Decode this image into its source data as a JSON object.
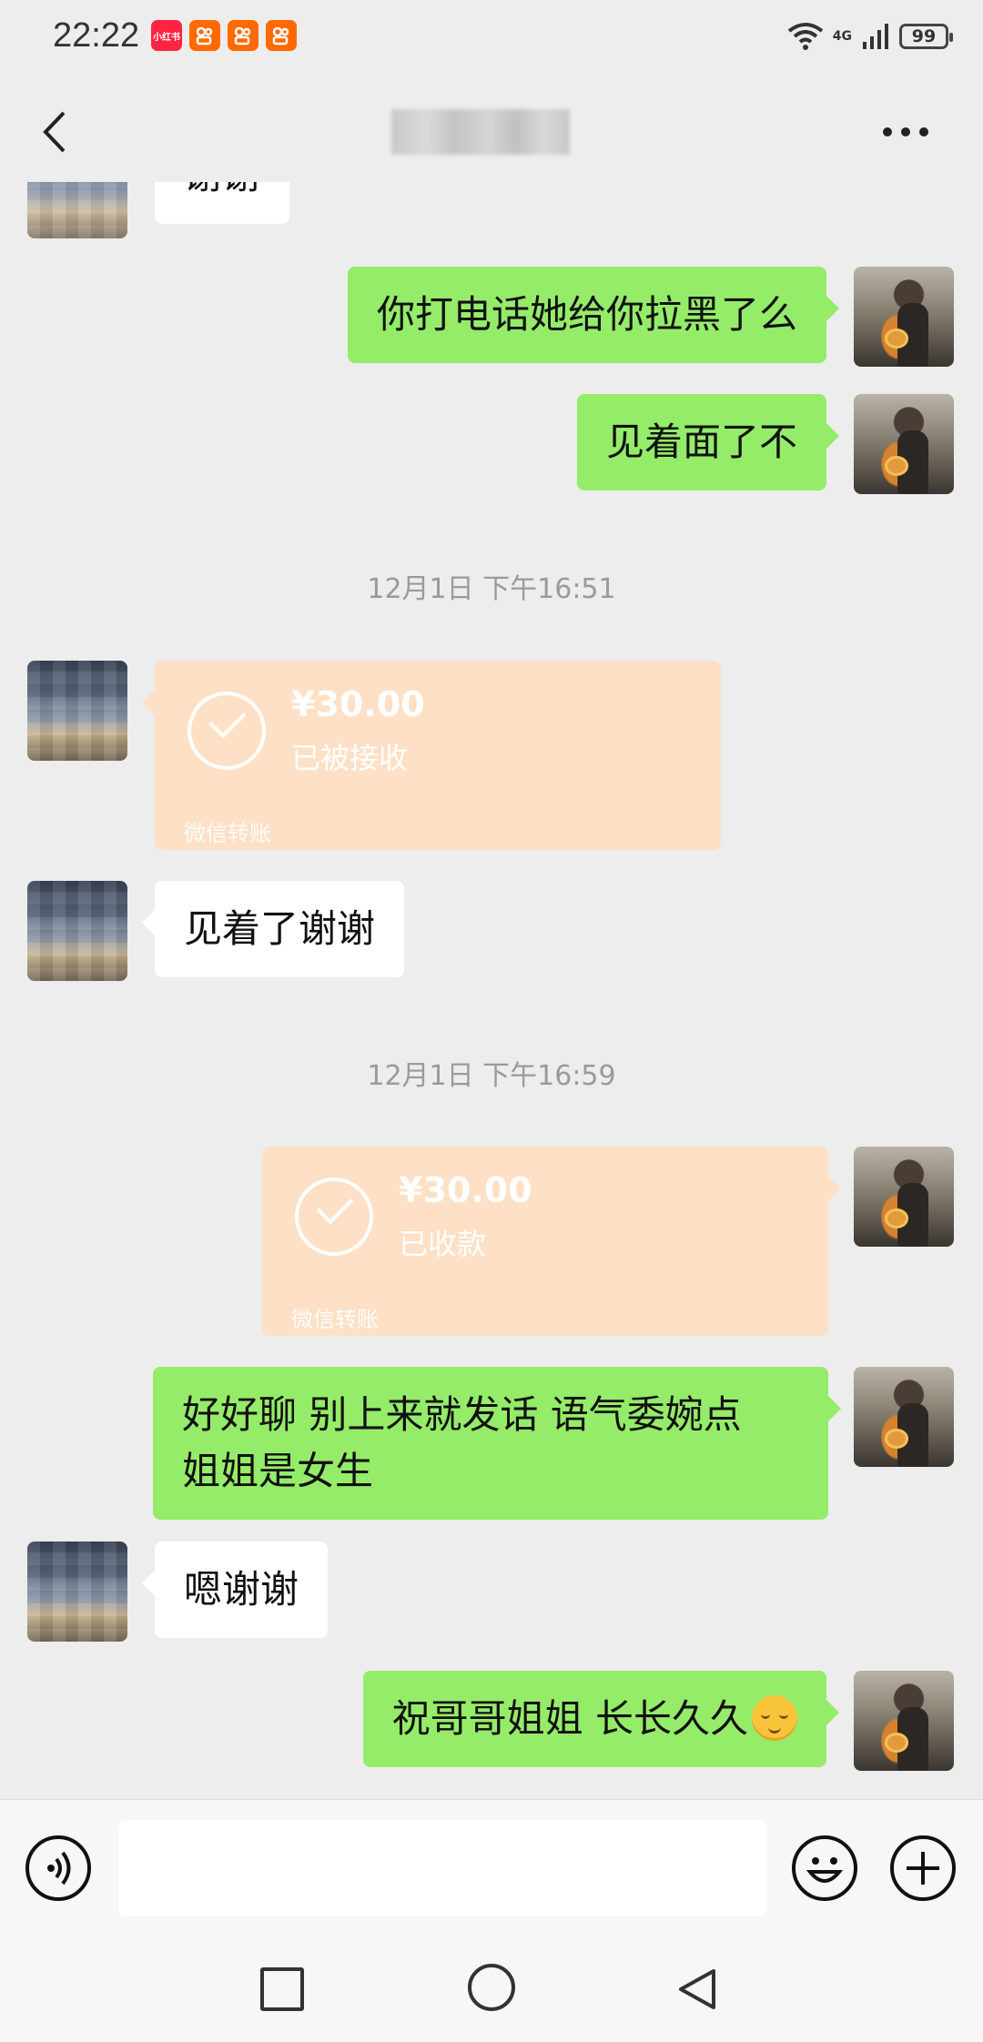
{
  "status_bar": {
    "time": "22:22",
    "apps": [
      {
        "name": "xiaohongshu-app-icon",
        "label": "小红书",
        "color": "#ff2442"
      },
      {
        "name": "kuaishou-app-icon",
        "label": "",
        "color": "#ff6a00"
      },
      {
        "name": "kuaishou-app-icon",
        "label": "",
        "color": "#ff6a00"
      },
      {
        "name": "kuaishou-app-icon",
        "label": "",
        "color": "#ff6a00"
      }
    ],
    "network": "4G",
    "battery": "99"
  },
  "header": {
    "back_icon": "chevron-left-icon",
    "more_icon": "more-dots-icon"
  },
  "messages": {
    "m0_left": "谢谢",
    "m1_right": "你打电话她给你拉黑了么",
    "m2_right": "见着面了不",
    "ts1": "12月1日 下午16:51",
    "transfer1": {
      "amount": "¥30.00",
      "status": "已被接收",
      "label": "微信转账"
    },
    "m3_left": "见着了谢谢",
    "ts2": "12月1日 下午16:59",
    "transfer2": {
      "amount": "¥30.00",
      "status": "已收款",
      "label": "微信转账"
    },
    "m4_right_line1": "好好聊 别上来就发话 语气委婉点",
    "m4_right_line2": "姐姐是女生",
    "m5_left": "嗯谢谢",
    "m6_right": "祝哥哥姐姐 长长久久",
    "m6_emoji": "smiling-face-emoji"
  },
  "input_bar": {
    "voice_icon": "voice-icon",
    "emoji_icon": "emoji-icon",
    "plus_icon": "plus-icon",
    "input_value": ""
  },
  "colors": {
    "background": "#ededed",
    "bubble_mine": "#95ec69",
    "bubble_other": "#ffffff",
    "transfer_card": "#fde0c6"
  }
}
